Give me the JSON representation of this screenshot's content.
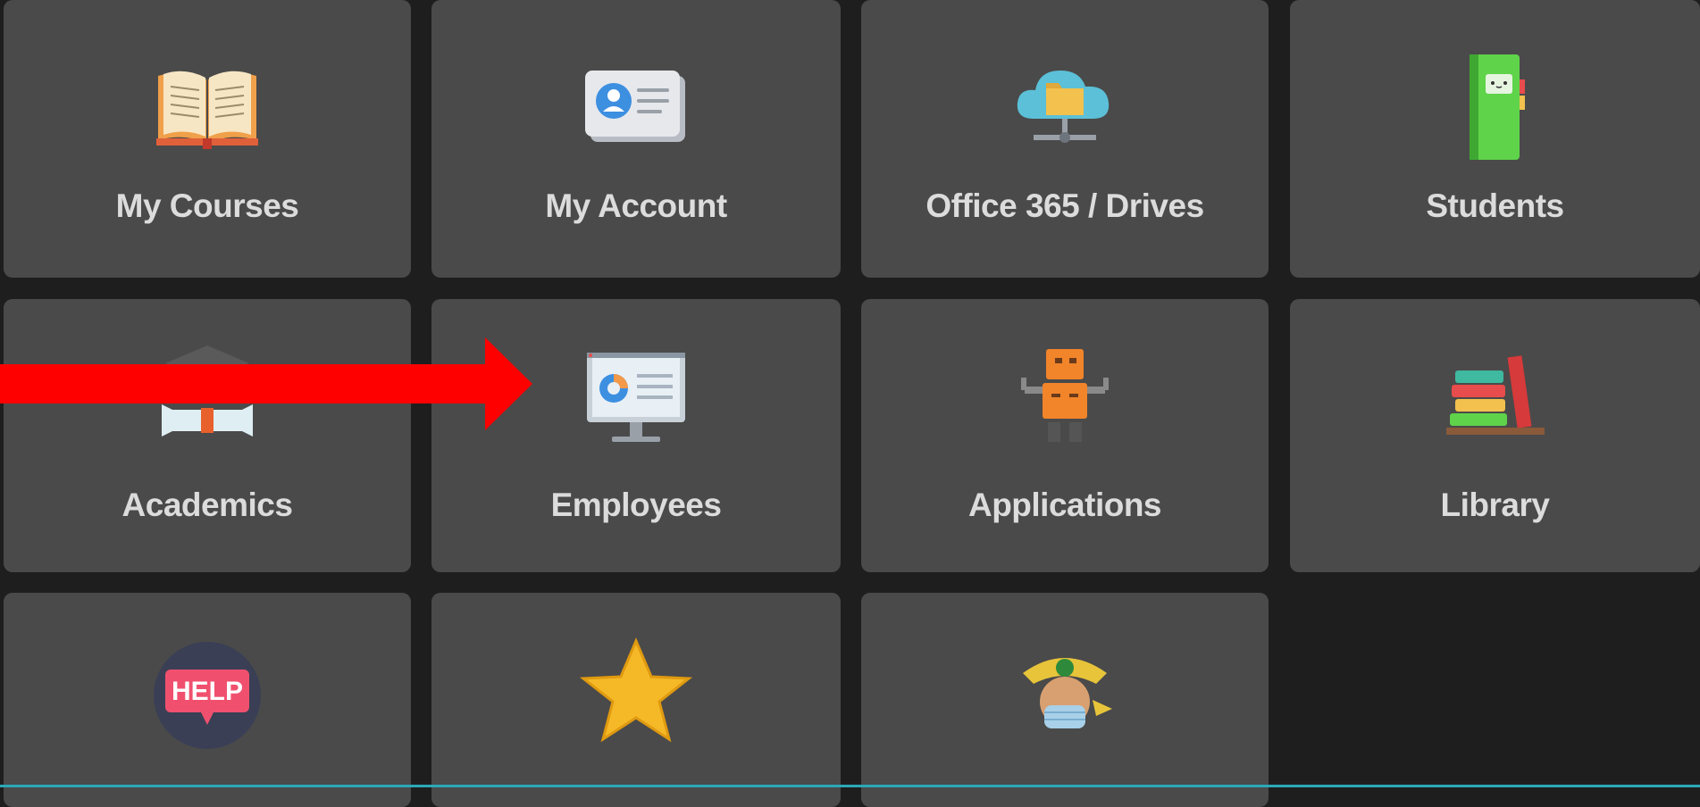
{
  "tiles": [
    {
      "label": "My Courses",
      "icon": "open-book-icon"
    },
    {
      "label": "My Account",
      "icon": "id-card-icon"
    },
    {
      "label": "Office 365 / Drives",
      "icon": "cloud-folder-icon"
    },
    {
      "label": "Students",
      "icon": "notebook-icon"
    },
    {
      "label": "Academics",
      "icon": "graduation-cap-icon"
    },
    {
      "label": "Employees",
      "icon": "monitor-chart-icon"
    },
    {
      "label": "Applications",
      "icon": "robot-icon"
    },
    {
      "label": "Library",
      "icon": "books-icon"
    },
    {
      "label": "",
      "icon": "help-bubble-icon",
      "icon_text": "HELP"
    },
    {
      "label": "",
      "icon": "star-icon"
    },
    {
      "label": "",
      "icon": "mascot-mask-icon"
    }
  ],
  "annotation": {
    "icon": "red-arrow-icon",
    "color": "#ff0000",
    "points_to": "Employees"
  },
  "colors": {
    "background": "#1e1e1e",
    "tile": "#4a4a4a",
    "label": "#dcdcdc"
  }
}
